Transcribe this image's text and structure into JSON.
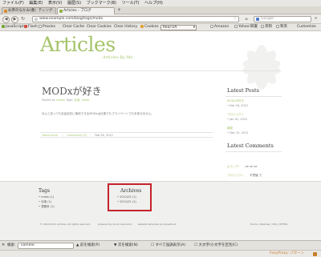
{
  "menubar": {
    "items": [
      "ファイル(F)",
      "編集(E)",
      "表示(V)",
      "履歴(S)",
      "ブックマーク(B)",
      "ツール(T)",
      "ヘルプ(H)"
    ]
  },
  "tabs": [
    {
      "label": "お茶のなかみ(番）ティング...",
      "active": false
    },
    {
      "label": "Articles - ブログ",
      "active": true
    }
  ],
  "nav": {
    "url": "www.example.com/blog/tags/modx",
    "search_placeholder": "Google"
  },
  "bookmarks": {
    "left": [
      "JavaScript",
      "Flash",
      "Proxies",
      "Clear Cache",
      "Clear Cookies",
      "Clear History",
      "Cookies"
    ],
    "ua_dropdown": "Real UA",
    "right": [
      "Amazon",
      "Yahoo!辞書",
      "英和",
      "和英",
      "Customize"
    ]
  },
  "site": {
    "title": "Articles",
    "tagline": "Articles By Me"
  },
  "post": {
    "title": "MODxが好き",
    "meta_posted": "Posted by",
    "meta_author": "admin",
    "meta_sep": "Tags:",
    "meta_tags": "仕事, modx",
    "body": "なんと言っても自由自在に使用できるMODxは仕事でもプライベートでも手放せません。",
    "read_more": "Read more",
    "comments": "Comments (0)",
    "date": "Feb 26, 2012"
  },
  "sidebar": {
    "latest_posts_title": "Latest Posts",
    "latest_posts": [
      {
        "title": "MODxが好き",
        "date": "Feb 26, 2012"
      },
      {
        "title": "プロジェクト",
        "date": "Jan 01, 2012"
      },
      {
        "title": "練習",
        "date": "Dec 31, 2011"
      }
    ],
    "latest_comments_title": "Latest Comments",
    "latest_comments": [
      {
        "title": "ようこそ!",
        "text": "ve ve ve"
      },
      {
        "title": "プロジェクト",
        "text": "不思議 で"
      }
    ]
  },
  "footer": {
    "tags_title": "Tags",
    "tags": [
      "modx (1)",
      "仕事 (1)",
      "雰囲気 (1)"
    ],
    "archives_title": "Archives",
    "archives": [
      "2012/02 (1)",
      "2012/01 (1)"
    ],
    "copyright": "© 2010-2011 Articles. All rights reserved.",
    "powered": "powered by modx revolution",
    "design": "website template by styleshout",
    "links": "Home | Sitemap | CSS | XHTML"
  },
  "findbar": {
    "label": "検索:",
    "value": "comme",
    "prev": "前を検索(P)",
    "next": "次を検索(N)",
    "highlight": "すべて強調表示(A)",
    "match_case": "大文字/小文字を区別(C)"
  },
  "status": {
    "foxy": "FoxyProxy: パターン"
  },
  "colors": {
    "accent": "#a5c46a",
    "highlight_box": "#c5232a"
  }
}
